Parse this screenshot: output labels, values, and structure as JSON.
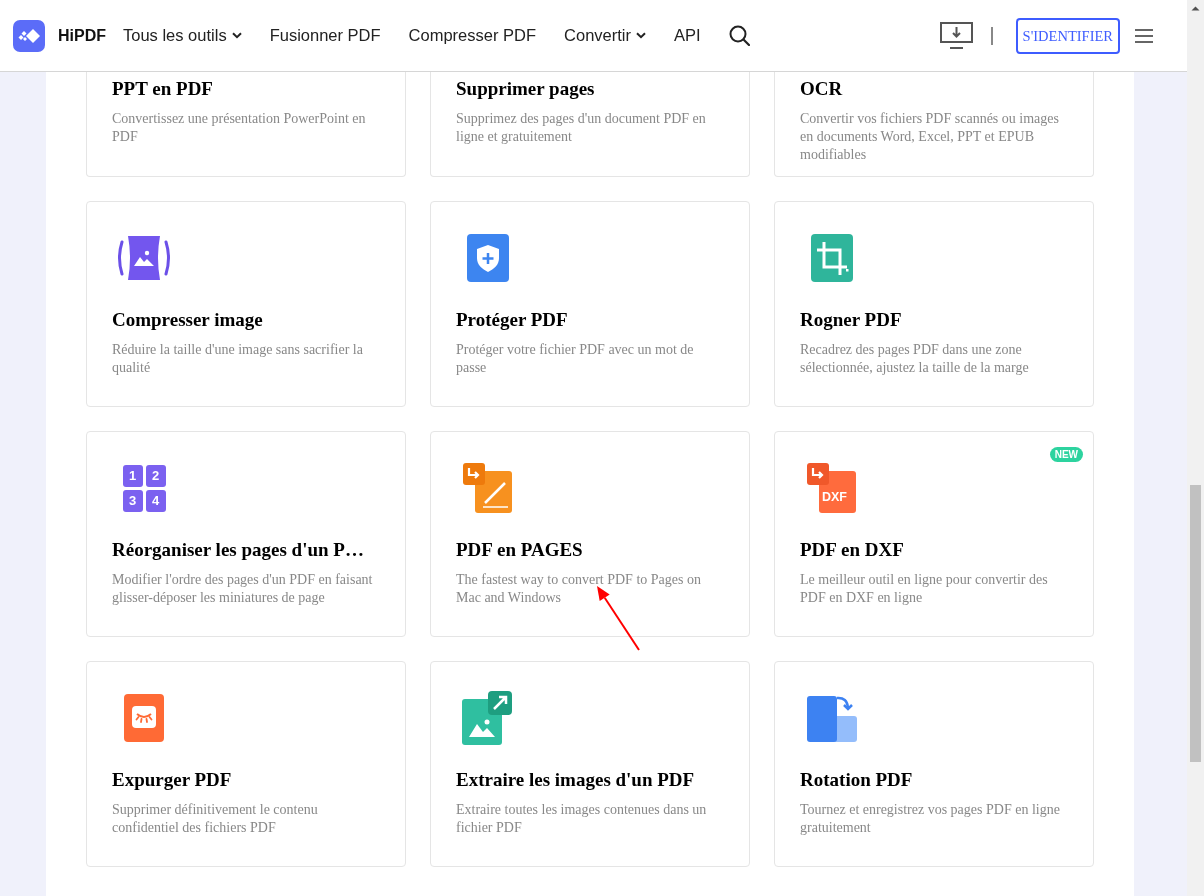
{
  "header": {
    "brand": "HiPDF",
    "nav": [
      {
        "label": "Tous les outils",
        "dropdown": true
      },
      {
        "label": "Fusionner PDF",
        "dropdown": false
      },
      {
        "label": "Compresser PDF",
        "dropdown": false
      },
      {
        "label": "Convertir",
        "dropdown": true
      },
      {
        "label": "API",
        "dropdown": false
      }
    ],
    "login_button": "S'IDENTIFIER"
  },
  "partial_cards": [
    {
      "title": "PPT en PDF",
      "description": "Convertissez une présentation PowerPoint en PDF"
    },
    {
      "title": "Supprimer pages",
      "description": "Supprimez des pages d'un document PDF en ligne et gratuitement"
    },
    {
      "title": "OCR",
      "description": "Convertir vos fichiers PDF scannés ou images en documents Word, Excel, PPT et EPUB modifiables"
    }
  ],
  "cards": [
    {
      "title": "Compresser image",
      "description": "Réduire la taille d'une image sans sacrifier la qualité"
    },
    {
      "title": "Protéger PDF",
      "description": "Protéger votre fichier PDF avec un mot de passe"
    },
    {
      "title": "Rogner PDF",
      "description": "Recadrez des pages PDF dans une zone sélectionnée, ajustez la taille de la marge"
    },
    {
      "title": "Réorganiser les pages d'un P…",
      "description": "Modifier l'ordre des pages d'un PDF en faisant glisser-déposer les miniatures de page",
      "icon_labels": [
        "1",
        "2",
        "3",
        "4"
      ]
    },
    {
      "title": "PDF en PAGES",
      "description": "The fastest way to convert PDF to Pages on Mac and Windows"
    },
    {
      "title": "PDF en DXF",
      "description": "Le meilleur outil en ligne pour convertir des PDF en DXF en ligne",
      "badge": "NEW",
      "icon_labels": [
        "DXF"
      ]
    },
    {
      "title": "Expurger PDF",
      "description": "Supprimer définitivement le contenu confidentiel des fichiers PDF"
    },
    {
      "title": "Extraire les images d'un PDF",
      "description": "Extraire toutes les images contenues dans un fichier PDF"
    },
    {
      "title": "Rotation PDF",
      "description": "Tournez et enregistrez vos pages PDF en ligne gratuitement"
    }
  ]
}
